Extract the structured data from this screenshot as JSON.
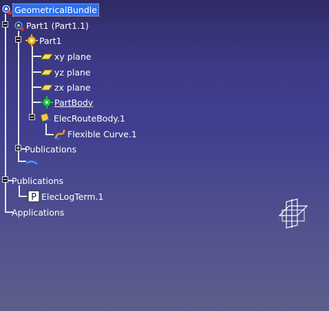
{
  "tree": {
    "root": {
      "label": "GeometricalBundle",
      "icon": "bundle-icon"
    },
    "part_instance": {
      "label": "Part1 (Part1.1)",
      "icon": "part-instance-icon"
    },
    "part": {
      "label": "Part1",
      "icon": "part-gear-icon"
    },
    "planes": [
      {
        "label": "xy plane",
        "icon": "plane-icon"
      },
      {
        "label": "yz plane",
        "icon": "plane-icon"
      },
      {
        "label": "zx plane",
        "icon": "plane-icon"
      }
    ],
    "part_body": {
      "label": "PartBody",
      "icon": "partbody-icon"
    },
    "elec_route_body": {
      "label": "ElecRouteBody.1",
      "icon": "route-body-icon"
    },
    "flexible_curve": {
      "label": "Flexible Curve.1",
      "icon": "flexible-curve-icon"
    },
    "publications_inner": {
      "label": "Publications"
    },
    "publications_outer": {
      "label": "Publications"
    },
    "elec_log_term": {
      "label": "ElecLogTerm.1",
      "icon": "log-term-icon"
    },
    "applications": {
      "label": "Applications"
    }
  },
  "colors": {
    "selection": "#2a6ff5",
    "text": "#ffffff",
    "tree_line": "#e8e8ee"
  },
  "compass": {
    "icon": "axis-compass-icon"
  }
}
